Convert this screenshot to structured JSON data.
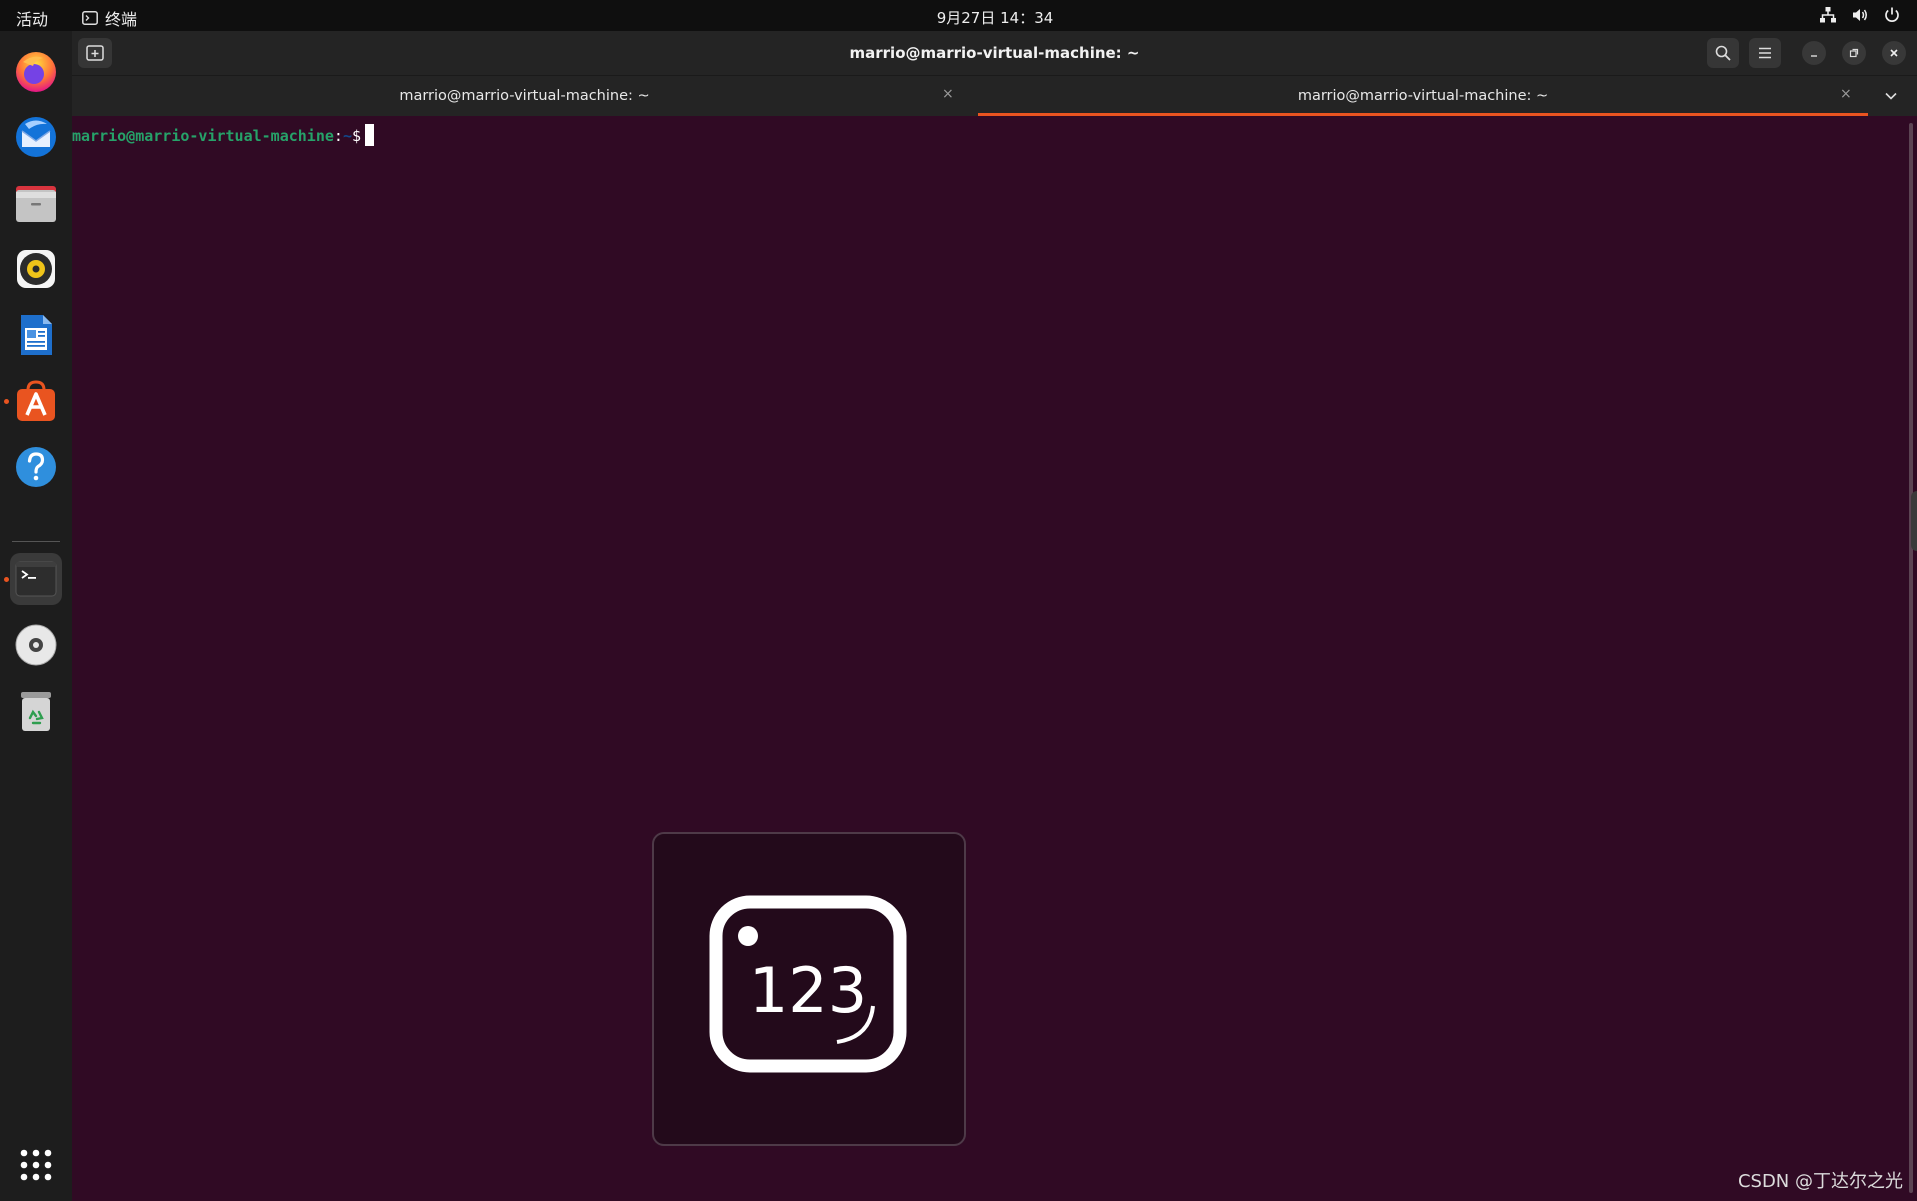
{
  "topbar": {
    "activities_label": "活动",
    "app_name": "终端",
    "clock": "9月27日 14：34"
  },
  "dock": {
    "items": [
      {
        "name": "Firefox",
        "icon": "firefox-icon"
      },
      {
        "name": "Thunderbird",
        "icon": "thunderbird-icon"
      },
      {
        "name": "Files",
        "icon": "files-icon"
      },
      {
        "name": "Rhythmbox",
        "icon": "rhythmbox-icon"
      },
      {
        "name": "LibreOffice Writer",
        "icon": "writer-icon"
      },
      {
        "name": "Ubuntu Software",
        "icon": "software-icon"
      },
      {
        "name": "Help",
        "icon": "help-icon"
      },
      {
        "name": "Terminal",
        "icon": "terminal-icon"
      },
      {
        "name": "Disc",
        "icon": "disc-icon"
      },
      {
        "name": "Trash",
        "icon": "trash-icon"
      }
    ],
    "apps_grid_icon": "apps-grid-icon"
  },
  "window": {
    "title": "marrio@marrio-virtual-machine: ~",
    "tabs": [
      {
        "label": "marrio@marrio-virtual-machine: ~",
        "active": false
      },
      {
        "label": "marrio@marrio-virtual-machine: ~",
        "active": true
      }
    ],
    "close_glyph": "×"
  },
  "terminal": {
    "user_host": "marrio@marrio-virtual-machine",
    "separator": ":",
    "path": "~",
    "symbol": "$"
  },
  "osd": {
    "label": "123",
    "icon": "numlock-icon"
  },
  "watermark": "CSDN @丁达尔之光",
  "colors": {
    "accent": "#e95420",
    "terminal_bg": "#300a24",
    "prompt_user": "#26a269",
    "prompt_path": "#12488b"
  }
}
